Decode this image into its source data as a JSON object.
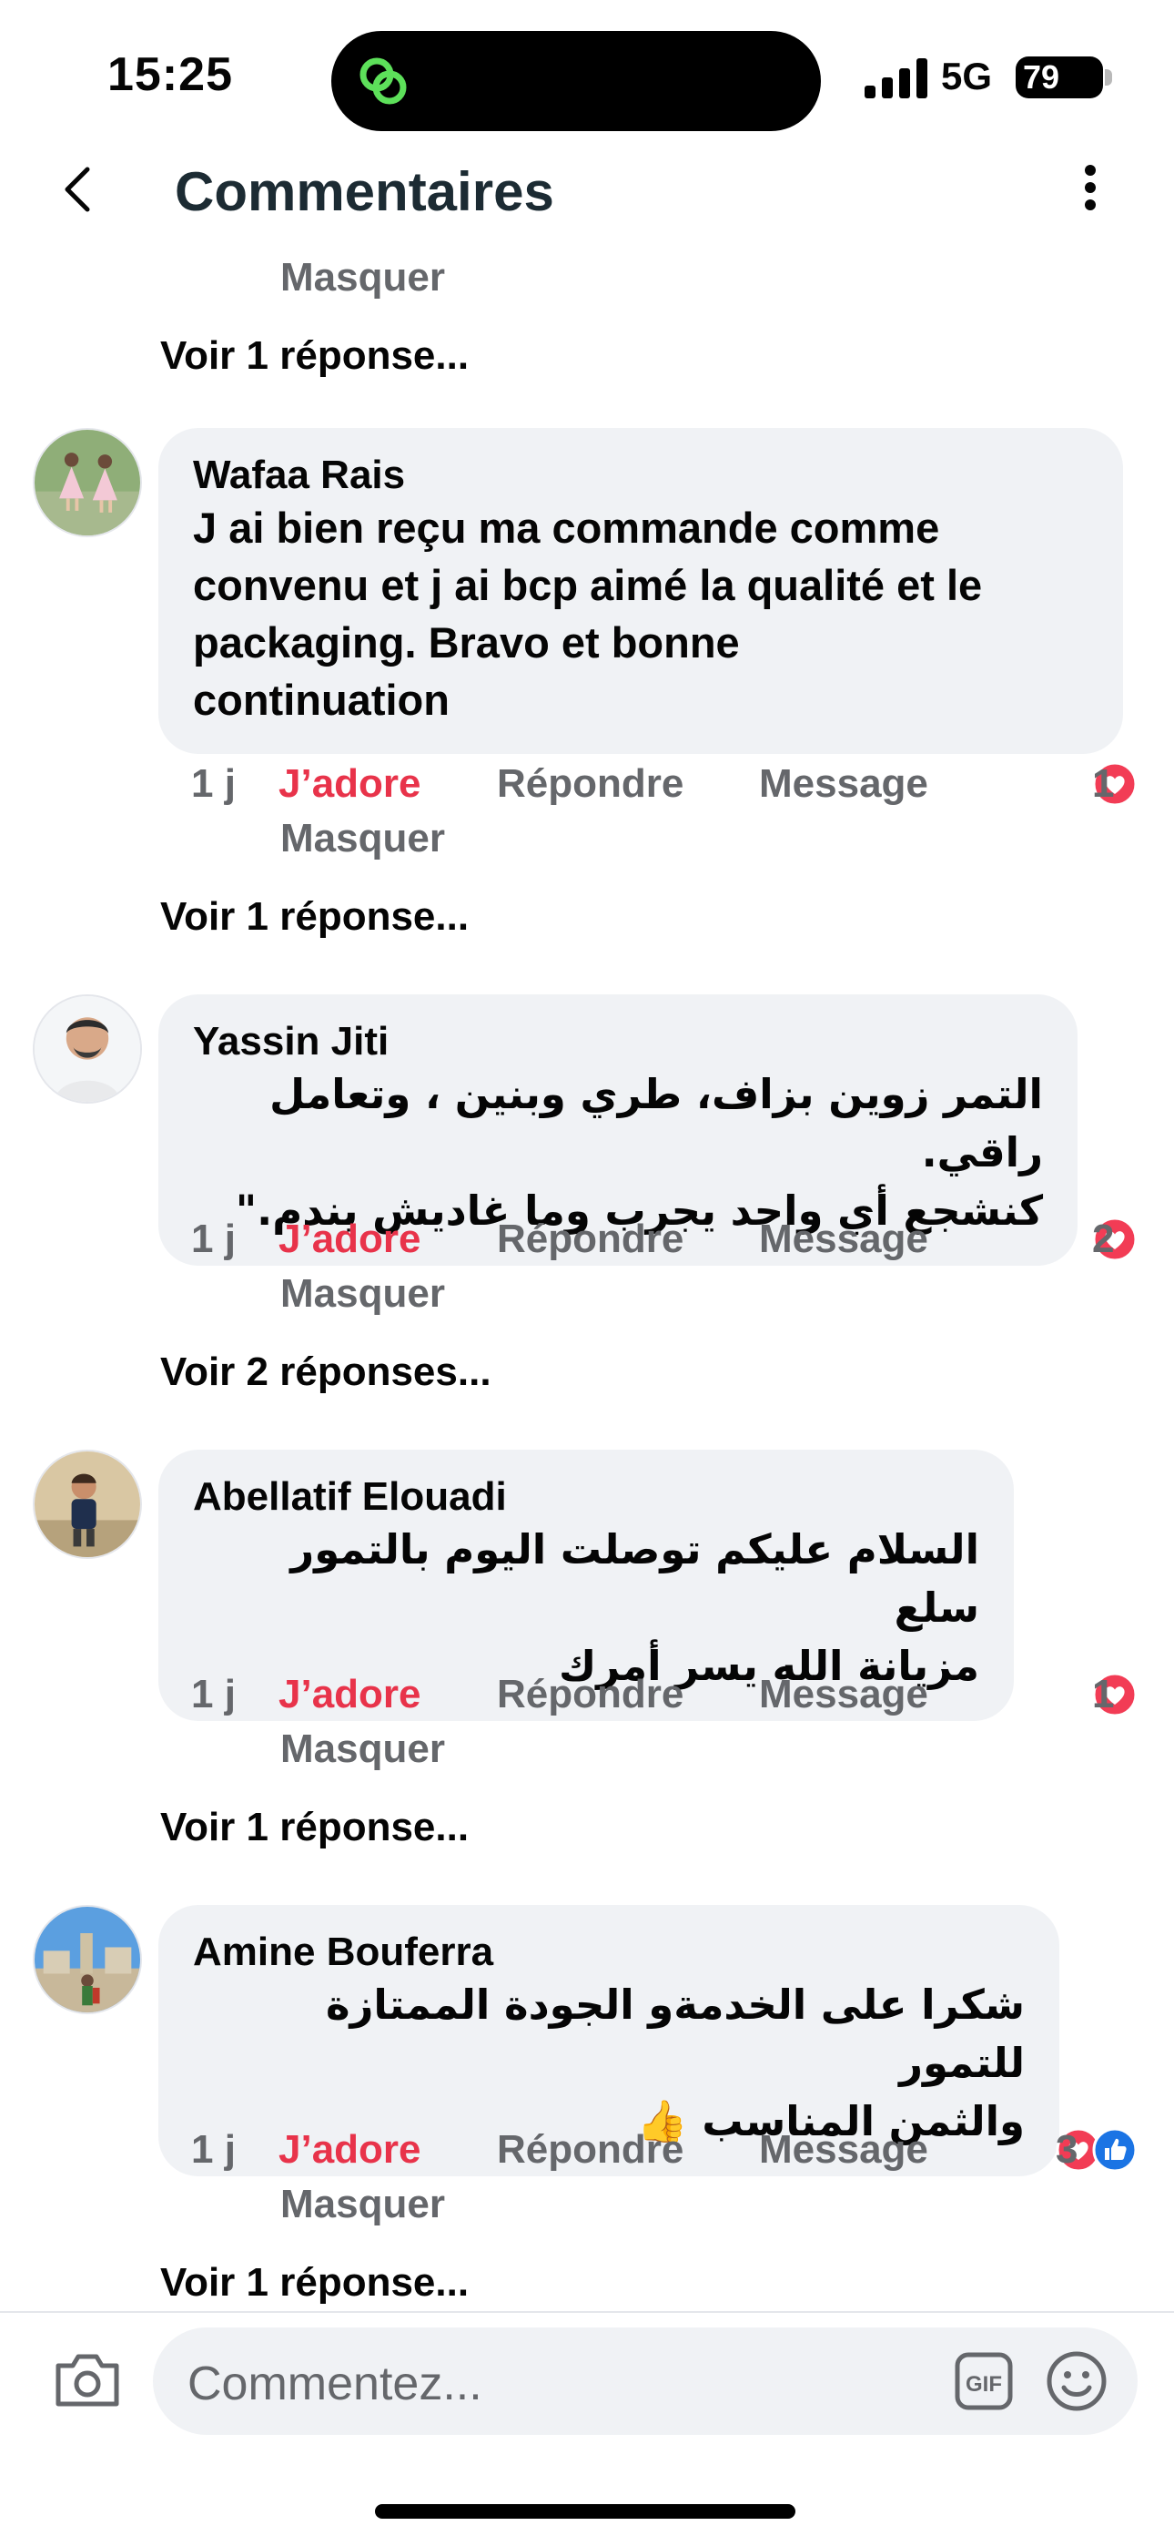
{
  "status_bar": {
    "time": "15:25",
    "network": "5G",
    "battery": "79"
  },
  "header": {
    "title": "Commentaires",
    "back_icon": "chevron-left-icon",
    "more_icon": "vertical-ellipsis-icon"
  },
  "top_partial": {
    "hide_label": "Masquer",
    "view_replies": "Voir 1 réponse..."
  },
  "comments": [
    {
      "author": "Wafaa Rais",
      "text": "J ai bien reçu ma commande comme\nconvenu et j ai bcp aimé la qualité et le\npackaging. Bravo et bonne\ncontinuation",
      "time": "1 j",
      "love_label": "J’adore",
      "reply_label": "Répondre",
      "message_label": "Message",
      "hide_label": "Masquer",
      "reaction_count": "1",
      "reactions": [
        "heart-reaction-icon"
      ],
      "view_replies": "Voir 1 réponse..."
    },
    {
      "author": "Yassin Jiti",
      "text": "التمر زوين بزاف، طري وبنين ، وتعامل راقي.\nكنشجع أي واحد يجرب وما غاديش يندم.\"",
      "time": "1 j",
      "love_label": "J’adore",
      "reply_label": "Répondre",
      "message_label": "Message",
      "hide_label": "Masquer",
      "reaction_count": "2",
      "reactions": [
        "heart-reaction-icon"
      ],
      "view_replies": "Voir 2 réponses..."
    },
    {
      "author": "Abellatif Elouadi",
      "text": "السلام عليكم توصلت اليوم بالتمور سلع\nمزيانة الله يسر أمرك",
      "time": "1 j",
      "love_label": "J’adore",
      "reply_label": "Répondre",
      "message_label": "Message",
      "hide_label": "Masquer",
      "reaction_count": "1",
      "reactions": [
        "heart-reaction-icon"
      ],
      "view_replies": "Voir 1 réponse..."
    },
    {
      "author": "Amine Bouferra",
      "text": "شكرا على الخدمةو الجودة الممتازة للتمور\nوالثمن المناسب 👍",
      "time": "1 j",
      "love_label": "J’adore",
      "reply_label": "Répondre",
      "message_label": "Message",
      "hide_label": "Masquer",
      "reaction_count": "3",
      "reactions": [
        "heart-reaction-icon",
        "like-reaction-icon"
      ],
      "view_replies": "Voir 1 réponse..."
    }
  ],
  "composer": {
    "placeholder": "Commentez...",
    "camera_icon": "camera-icon",
    "gif_icon": "gif-icon",
    "emoji_icon": "emoji-icon"
  },
  "colors": {
    "love_red": "#e8334a",
    "secondary_text": "#65676b",
    "bubble_bg": "#f0f2f5",
    "like_blue": "#1b74e4"
  }
}
